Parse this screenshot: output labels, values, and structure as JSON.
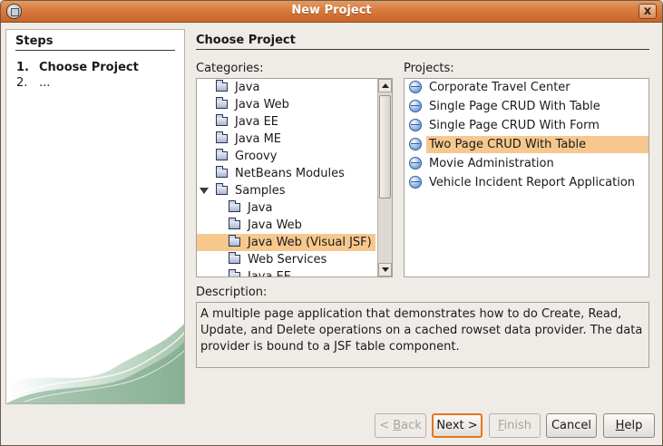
{
  "window": {
    "title": "New Project",
    "close_label": "x"
  },
  "steps": {
    "heading": "Steps",
    "items": [
      {
        "num": "1.",
        "label": "Choose Project"
      },
      {
        "num": "2.",
        "label": "..."
      }
    ]
  },
  "panel": {
    "title": "Choose Project",
    "categories_label": "Categories:",
    "projects_label": "Projects:",
    "description_label": "Description:"
  },
  "categories": [
    {
      "label": "Java"
    },
    {
      "label": "Java Web"
    },
    {
      "label": "Java EE"
    },
    {
      "label": "Java ME"
    },
    {
      "label": "Groovy"
    },
    {
      "label": "NetBeans Modules"
    },
    {
      "label": "Samples"
    },
    {
      "label": "Java"
    },
    {
      "label": "Java Web"
    },
    {
      "label": "Java Web (Visual JSF)"
    },
    {
      "label": "Web Services"
    },
    {
      "label": "Java EE"
    }
  ],
  "projects": [
    {
      "label": "Corporate Travel Center"
    },
    {
      "label": "Single Page CRUD With Table"
    },
    {
      "label": "Single Page CRUD With Form"
    },
    {
      "label": "Two Page CRUD With Table"
    },
    {
      "label": "Movie Administration"
    },
    {
      "label": "Vehicle Incident Report Application"
    }
  ],
  "description": "A multiple page application that demonstrates how to do Create, Read, Update, and Delete operations on a cached rowset data provider. The data provider is bound to a JSF table component.",
  "buttons": {
    "back": {
      "pre": "< ",
      "mn": "B",
      "post": "ack"
    },
    "next": {
      "pre": "Next ",
      "mn": "",
      "post": ">"
    },
    "finish": {
      "pre": "",
      "mn": "F",
      "post": "inish"
    },
    "cancel": {
      "pre": "Cancel",
      "mn": "",
      "post": ""
    },
    "help": {
      "pre": "",
      "mn": "H",
      "post": "elp"
    }
  },
  "colors": {
    "titlebar": "#d97a3d",
    "selection": "#f7c88e",
    "default_button_border": "#e3761d"
  }
}
